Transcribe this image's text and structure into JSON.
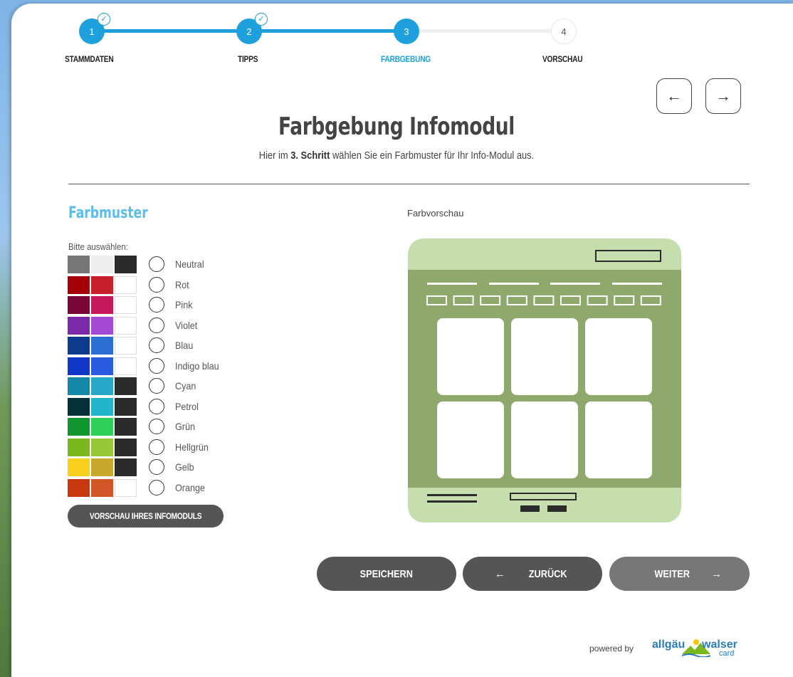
{
  "stepper": {
    "steps": [
      {
        "number": "1",
        "label": "STAMMDATEN",
        "state": "done"
      },
      {
        "number": "2",
        "label": "TIPPS",
        "state": "done"
      },
      {
        "number": "3",
        "label": "FARBGEBUNG",
        "state": "active"
      },
      {
        "number": "4",
        "label": "VORSCHAU",
        "state": "todo"
      }
    ],
    "check_glyph": "✓"
  },
  "nav": {
    "prev_glyph": "←",
    "next_glyph": "→"
  },
  "header": {
    "title": "Farbgebung Infomodul",
    "subtitle_pre": "Hier im ",
    "subtitle_bold": "3. Schritt",
    "subtitle_post": " wählen Sie ein Farbmuster für Ihr Info-Modul aus."
  },
  "farbmuster": {
    "title": "Farbmuster",
    "hint": "Bitte auswählen:",
    "options": [
      {
        "label": "Neutral",
        "colors": [
          "#777777",
          "#eeeeee",
          "#2b2b2b"
        ]
      },
      {
        "label": "Rot",
        "colors": [
          "#a4000a",
          "#c8202a",
          "#ffffff"
        ]
      },
      {
        "label": "Pink",
        "colors": [
          "#7a0436",
          "#c41a5c",
          "#ffffff"
        ]
      },
      {
        "label": "Violet",
        "colors": [
          "#7a2aa8",
          "#a24ad4",
          "#ffffff"
        ]
      },
      {
        "label": "Blau",
        "colors": [
          "#0e3a8e",
          "#2a6ed2",
          "#ffffff"
        ]
      },
      {
        "label": "Indigo blau",
        "colors": [
          "#1036c8",
          "#2a5ae0",
          "#ffffff"
        ]
      },
      {
        "label": "Cyan",
        "colors": [
          "#1388a8",
          "#28a8c8",
          "#2b2b2b"
        ]
      },
      {
        "label": "Petrol",
        "colors": [
          "#06303a",
          "#22b4c8",
          "#2b2b2b"
        ]
      },
      {
        "label": "Grün",
        "colors": [
          "#10962e",
          "#2ed05a",
          "#2b2b2b"
        ]
      },
      {
        "label": "Hellgrün",
        "colors": [
          "#7ab81e",
          "#96c83a",
          "#2b2b2b"
        ]
      },
      {
        "label": "Gelb",
        "colors": [
          "#f8d01c",
          "#c8a82a",
          "#2b2b2b"
        ]
      },
      {
        "label": "Orange",
        "colors": [
          "#c8380e",
          "#d05628",
          "#ffffff"
        ]
      }
    ],
    "preview_button": "VORSCHAU IHRES INFOMODULS"
  },
  "farbvorschau": {
    "label": "Farbvorschau",
    "colors": {
      "outer": "#c6ddae",
      "inner": "#8fa96d",
      "tiles": "#ffffff",
      "lines": "#2b2b2b"
    }
  },
  "actions": {
    "save": "SPEICHERN",
    "back_arrow": "←",
    "back": "ZURÜCK",
    "next": "WEITER",
    "next_arrow": "→"
  },
  "footer": {
    "powered_by": "powered by",
    "logo_word1": "allgäu",
    "logo_word2": "walser",
    "logo_word3": "card"
  },
  "colors": {
    "accent": "#1ea0dc",
    "button_dark": "#555555",
    "button_light": "#777777"
  }
}
